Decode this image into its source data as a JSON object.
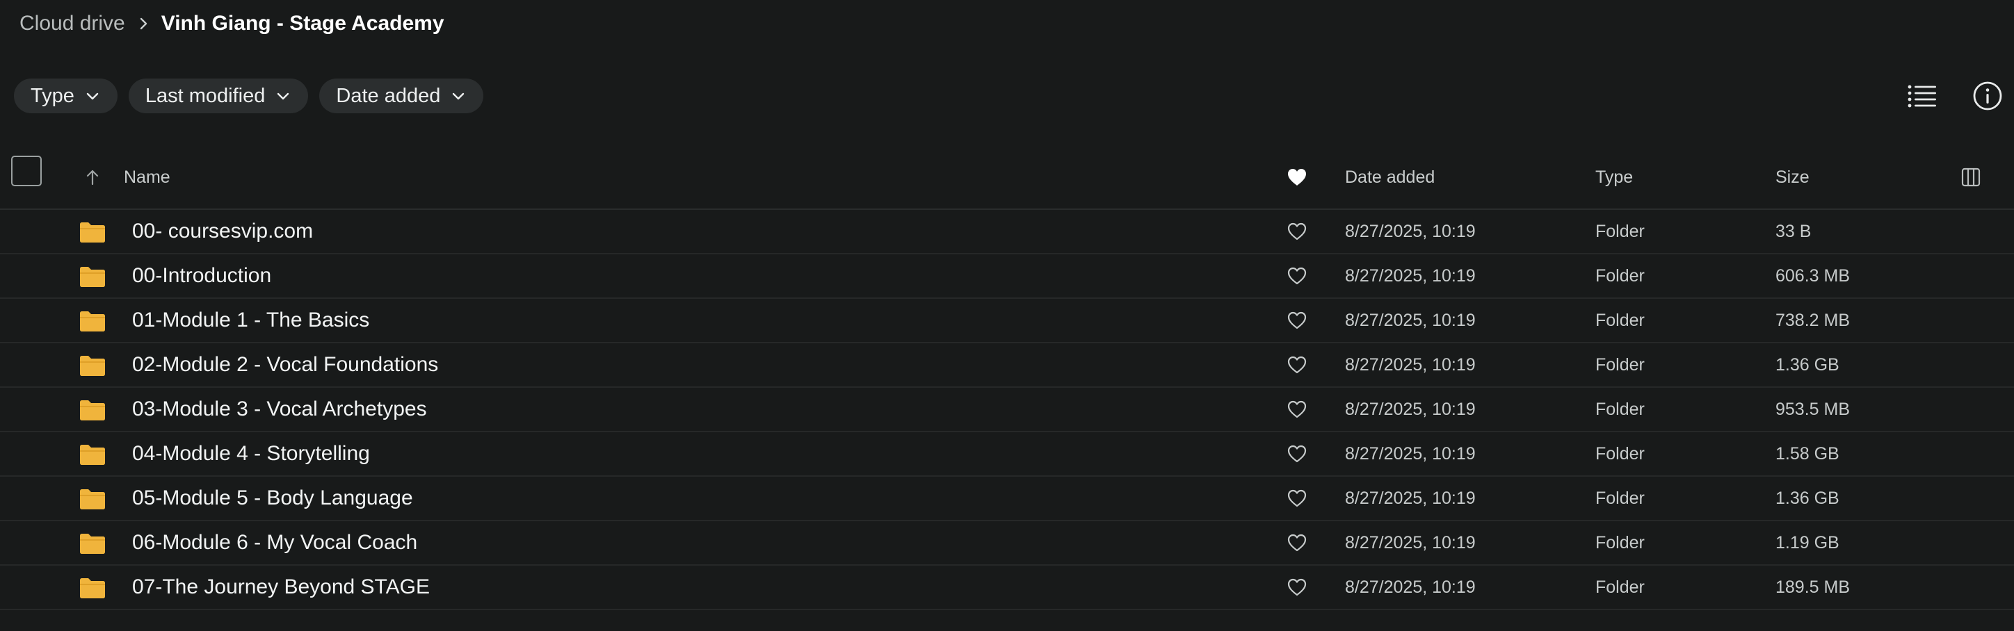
{
  "breadcrumb": {
    "root": "Cloud drive",
    "current": "Vinh Giang - Stage Academy"
  },
  "filters": [
    {
      "label": "Type"
    },
    {
      "label": "Last modified"
    },
    {
      "label": "Date added"
    }
  ],
  "icons": {
    "list_view": "list-view-icon",
    "info": "info-icon",
    "columns": "columns-icon",
    "folder": "folder-icon",
    "favorite": "heart-icon"
  },
  "colors": {
    "background": "#181a1a",
    "folder": "#f0b43c",
    "chip": "#2b2e2f"
  },
  "table": {
    "headers": {
      "name": "Name",
      "date_added": "Date added",
      "type": "Type",
      "size": "Size"
    },
    "sort": {
      "column": "Name",
      "direction": "ascending"
    },
    "rows": [
      {
        "name": "00- coursesvip.com",
        "date": "8/27/2025, 10:19",
        "type": "Folder",
        "size": "33 B"
      },
      {
        "name": "00-Introduction",
        "date": "8/27/2025, 10:19",
        "type": "Folder",
        "size": "606.3 MB"
      },
      {
        "name": "01-Module 1 - The Basics",
        "date": "8/27/2025, 10:19",
        "type": "Folder",
        "size": "738.2 MB"
      },
      {
        "name": "02-Module 2 - Vocal Foundations",
        "date": "8/27/2025, 10:19",
        "type": "Folder",
        "size": "1.36 GB"
      },
      {
        "name": "03-Module 3 - Vocal Archetypes",
        "date": "8/27/2025, 10:19",
        "type": "Folder",
        "size": "953.5 MB"
      },
      {
        "name": "04-Module 4 - Storytelling",
        "date": "8/27/2025, 10:19",
        "type": "Folder",
        "size": "1.58 GB"
      },
      {
        "name": "05-Module 5 - Body Language",
        "date": "8/27/2025, 10:19",
        "type": "Folder",
        "size": "1.36 GB"
      },
      {
        "name": "06-Module 6 - My Vocal Coach",
        "date": "8/27/2025, 10:19",
        "type": "Folder",
        "size": "1.19 GB"
      },
      {
        "name": "07-The Journey Beyond STAGE",
        "date": "8/27/2025, 10:19",
        "type": "Folder",
        "size": "189.5 MB"
      }
    ]
  }
}
